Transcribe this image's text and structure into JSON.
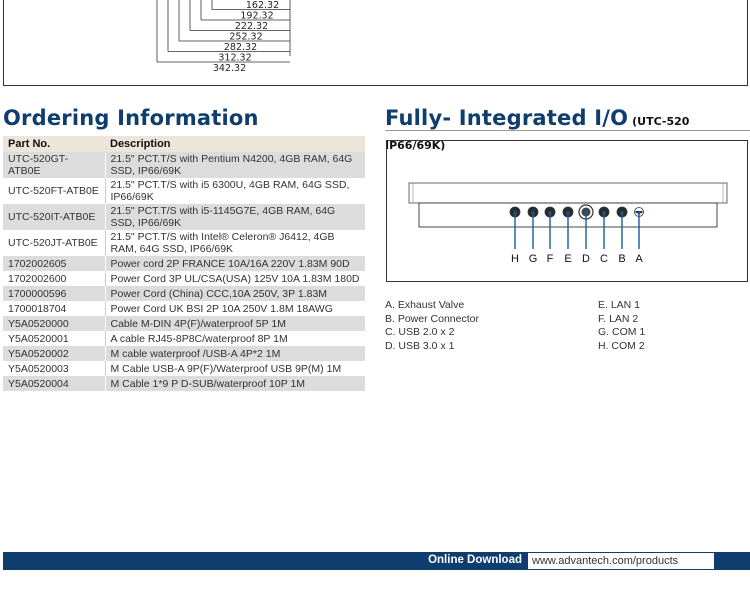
{
  "dimension_drawing": {
    "labels": [
      "162.32",
      "192.32",
      "222.32",
      "252.32",
      "282.32",
      "312.32",
      "342.32"
    ]
  },
  "ordering": {
    "title": "Ordering Information",
    "columns": [
      "Part No.",
      "Description"
    ],
    "rows": [
      {
        "part": "UTC-520GT-ATB0E",
        "desc": "21.5\" PCT.T/S with Pentium N4200, 4GB RAM, 64G SSD, IP66/69K"
      },
      {
        "part": "UTC-520FT-ATB0E",
        "desc": "21.5\" PCT.T/S with i5 6300U, 4GB RAM, 64G SSD, IP66/69K"
      },
      {
        "part": "UTC-520IT-ATB0E",
        "desc": "21.5\" PCT.T/S with i5-1145G7E, 4GB RAM, 64G SSD, IP66/69K"
      },
      {
        "part": "UTC-520JT-ATB0E",
        "desc": "21.5\" PCT.T/S with Intel® Celeron® J6412, 4GB RAM, 64G SSD, IP66/69K"
      },
      {
        "part": "1702002605",
        "desc": "Power cord 2P FRANCE 10A/16A 220V 1.83M 90D"
      },
      {
        "part": "1702002600",
        "desc": "Power Cord 3P UL/CSA(USA) 125V 10A 1.83M 180D"
      },
      {
        "part": "1700000596",
        "desc": "Power Cord (China) CCC,10A 250V, 3P 1.83M"
      },
      {
        "part": "1700018704",
        "desc": "Power Cord UK BSI 2P 10A 250V 1.8M 18AWG"
      },
      {
        "part": "Y5A0520000",
        "desc": "Cable M-DIN 4P(F)/waterproof 5P 1M"
      },
      {
        "part": "Y5A0520001",
        "desc": "A cable RJ45-8P8C/waterproof 8P 1M"
      },
      {
        "part": "Y5A0520002",
        "desc": "M cable waterproof /USB-A 4P*2 1M"
      },
      {
        "part": "Y5A0520003",
        "desc": "M Cable USB-A 9P(F)/Waterproof USB 9P(M) 1M"
      },
      {
        "part": "Y5A0520004",
        "desc": "M Cable 1*9 P D-SUB/waterproof 10P 1M"
      }
    ]
  },
  "io": {
    "title": "Fully- Integrated I/O",
    "subtitle": "(UTC-520 IP66/69K)",
    "port_letters": [
      "H",
      "G",
      "F",
      "E",
      "D",
      "C",
      "B",
      "A"
    ],
    "legend_left": [
      "A. Exhaust Valve",
      "B. Power Connector",
      "C. USB 2.0 x 2",
      "D. USB 3.0 x 1"
    ],
    "legend_right": [
      "E. LAN 1",
      "F. LAN 2",
      "G. COM 1",
      "H. COM 2"
    ],
    "accent_color": "#1a5a9a"
  },
  "footer": {
    "label": "Online Download",
    "url": "www.advantech.com/products",
    "bar_color": "#0e3d6e"
  }
}
